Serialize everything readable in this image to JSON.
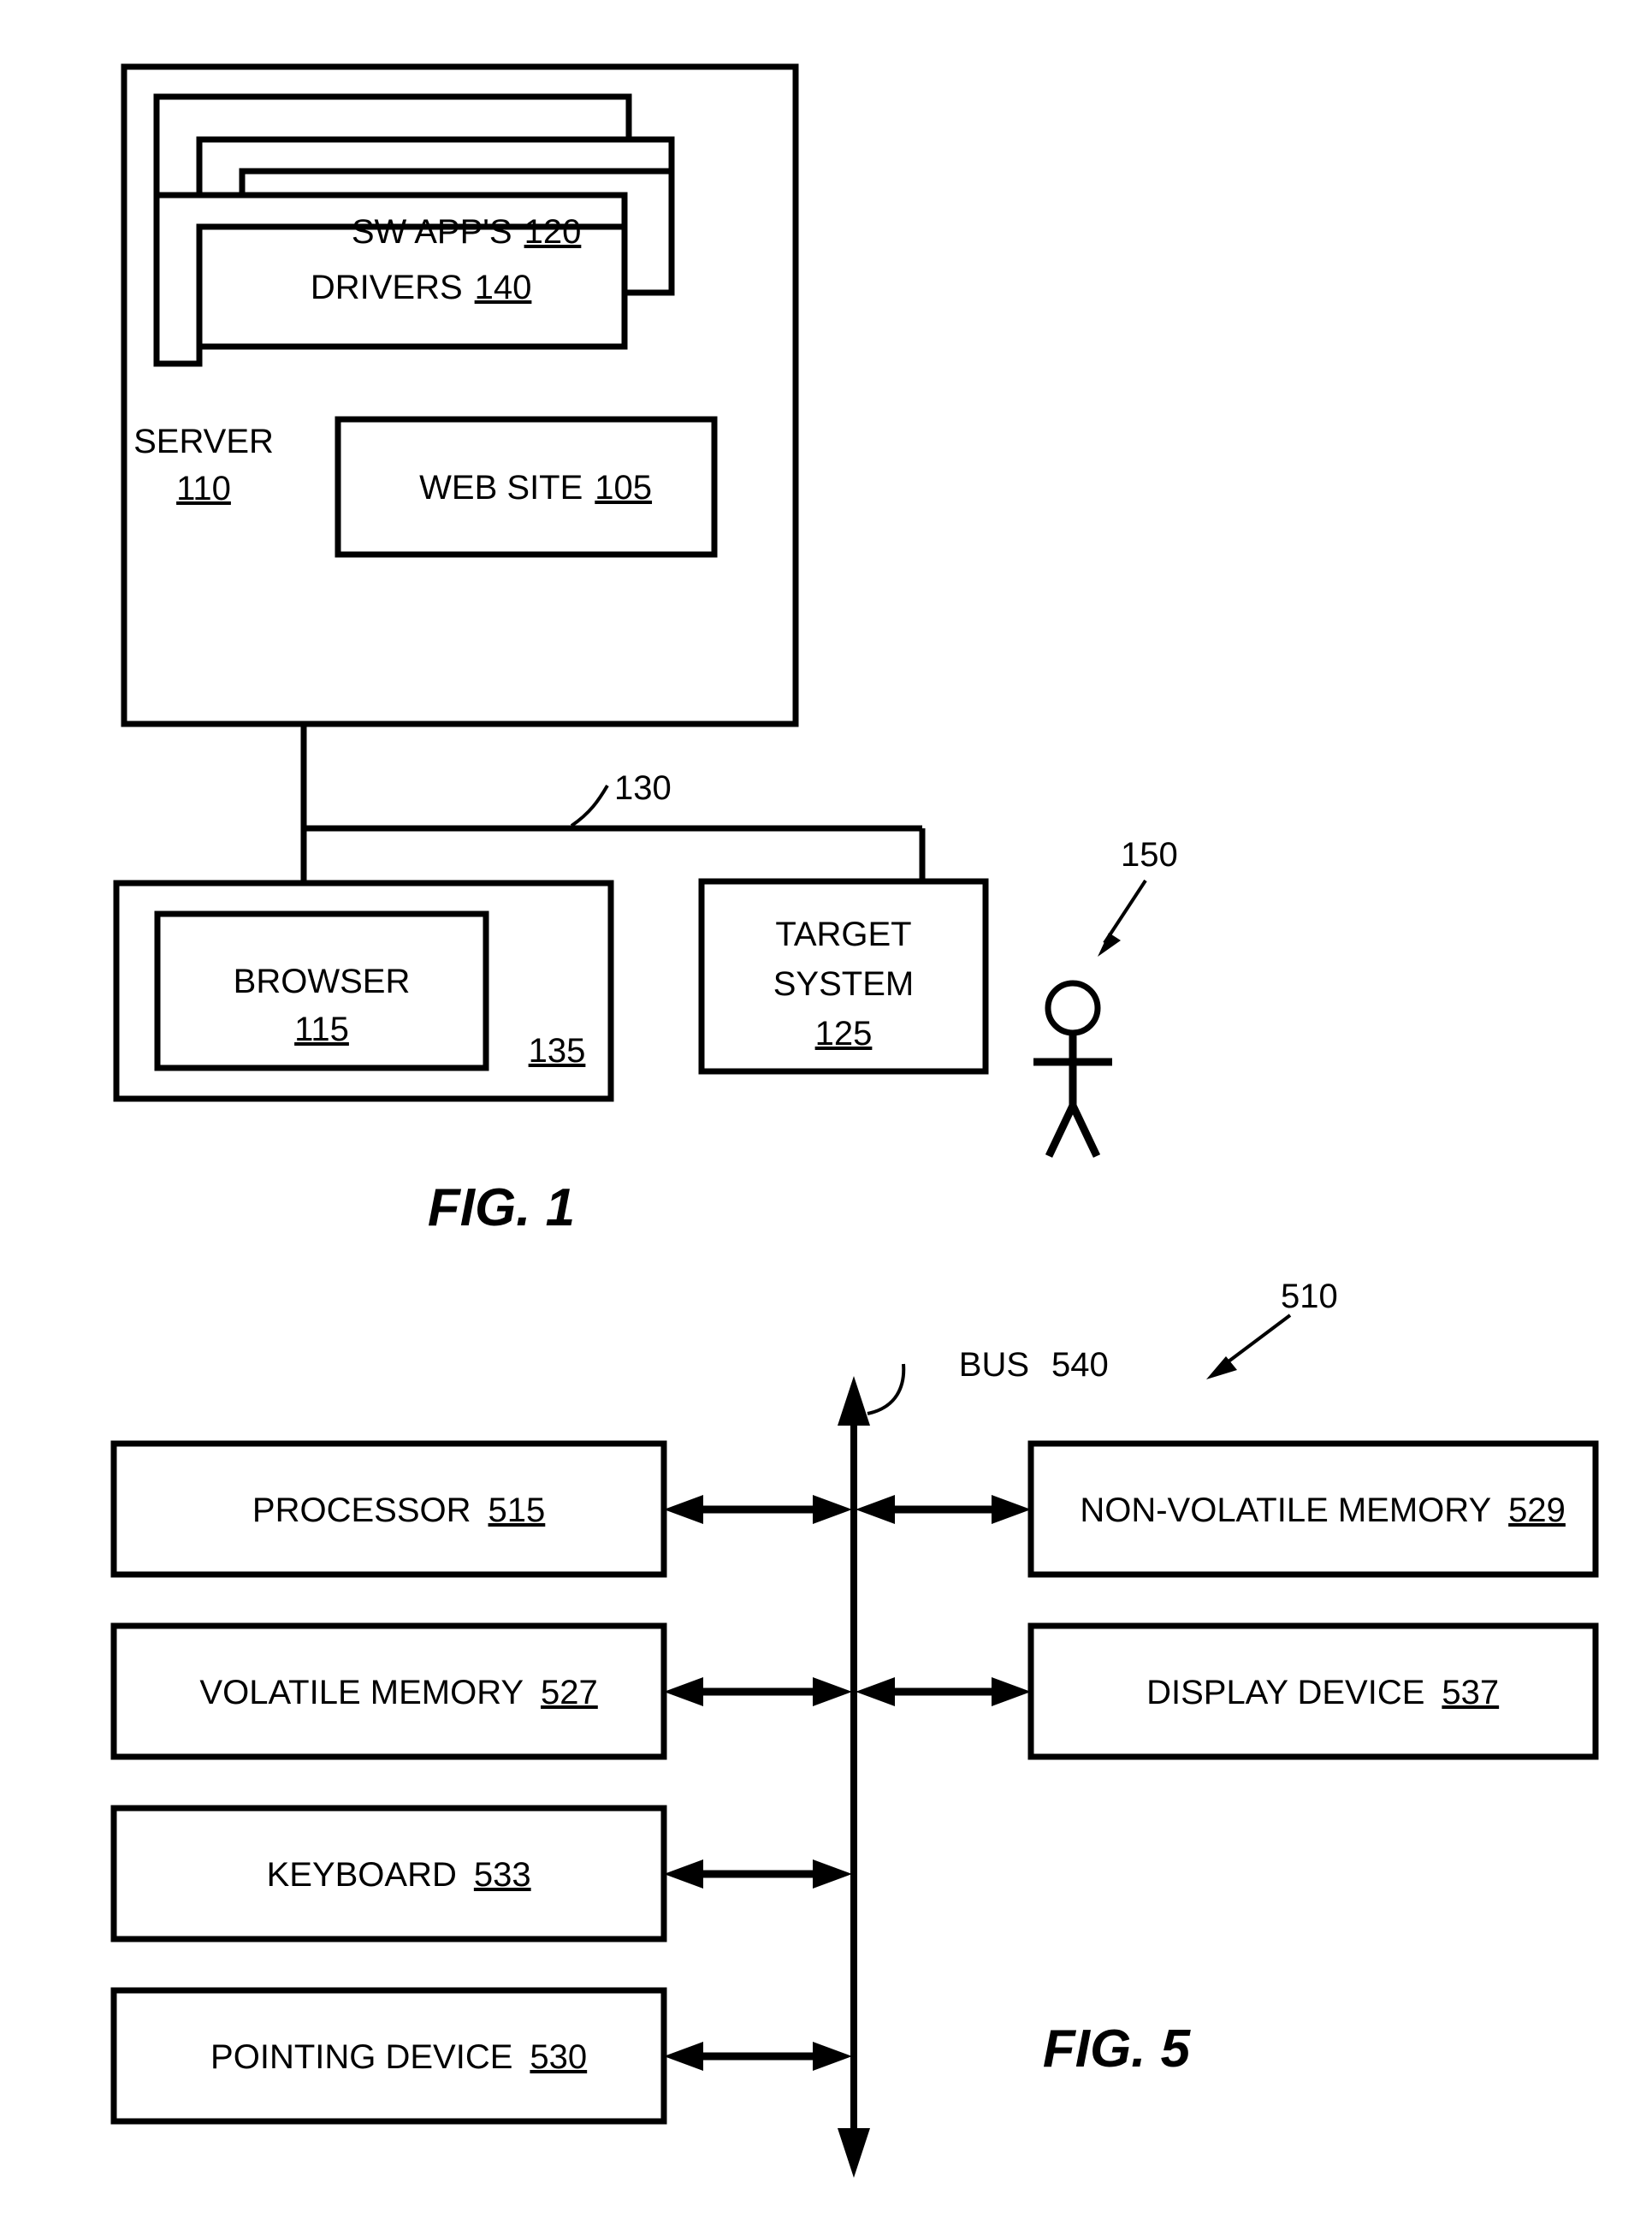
{
  "document": {
    "type": "patent-drawing-sheet",
    "figures": [
      "FIG. 1",
      "FIG. 5"
    ]
  },
  "fig1": {
    "caption": "FIG. 1",
    "server": {
      "label": "SERVER",
      "ref": "110"
    },
    "sw_apps": {
      "label": "SW APP'S",
      "ref": "120",
      "stack_count": 3
    },
    "drivers": {
      "label": "DRIVERS",
      "ref": "140",
      "stack_count": 2
    },
    "web_site": {
      "label": "WEB SITE",
      "ref": "105"
    },
    "network": {
      "ref": "130"
    },
    "client": {
      "ref": "135"
    },
    "browser": {
      "label": "BROWSER",
      "ref": "115"
    },
    "target_system": {
      "label_line1": "TARGET",
      "label_line2": "SYSTEM",
      "ref": "125"
    },
    "user": {
      "ref": "150",
      "icon": "stick-figure-person-icon"
    }
  },
  "fig5": {
    "caption": "FIG. 5",
    "system_ref": "510",
    "bus": {
      "label": "BUS",
      "ref": "540"
    },
    "left_components": [
      {
        "label": "PROCESSOR",
        "ref": "515"
      },
      {
        "label": "VOLATILE MEMORY",
        "ref": "527"
      },
      {
        "label": "KEYBOARD",
        "ref": "533"
      },
      {
        "label": "POINTING DEVICE",
        "ref": "530"
      }
    ],
    "right_components": [
      {
        "label": "NON-VOLATILE MEMORY",
        "ref": "529"
      },
      {
        "label": "DISPLAY DEVICE",
        "ref": "537"
      }
    ]
  },
  "colors": {
    "ink": "#000000",
    "paper": "#ffffff"
  }
}
